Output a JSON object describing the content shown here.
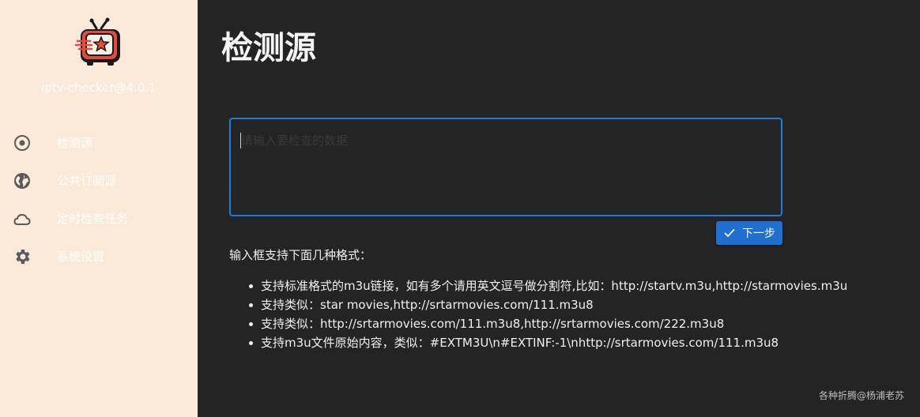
{
  "app": {
    "version": "iptv-checker@4.0.1",
    "logo_icon": "retro-tv-logo"
  },
  "sidebar": {
    "items": [
      {
        "label": "检测源",
        "icon": "radio-button-icon"
      },
      {
        "label": "公共订阅源",
        "icon": "globe-icon"
      },
      {
        "label": "定时检查任务",
        "icon": "cloud-icon"
      },
      {
        "label": "系统设置",
        "icon": "gear-icon"
      }
    ]
  },
  "main": {
    "title": "检测源",
    "input": {
      "value": "",
      "placeholder": "请输入要检查的数据"
    },
    "next_button": {
      "label": "下一步",
      "icon": "check-icon"
    },
    "help": {
      "title": "输入框支持下面几种格式：",
      "items": [
        "支持标准格式的m3u链接，如有多个请用英文逗号做分割符,比如：http://startv.m3u,http://starmovies.m3u",
        "支持类似：star movies,http://srtarmovies.com/111.m3u8",
        "支持类似：http://srtarmovies.com/111.m3u8,http://srtarmovies.com/222.m3u8",
        "支持m3u文件原始内容，类似：#EXTM3U\\n#EXTINF:-1\\nhttp://srtarmovies.com/111.m3u8"
      ]
    }
  },
  "watermark": "各种折腾@杨浦老苏",
  "colors": {
    "sidebar_bg": "#fbeada",
    "main_bg": "#242424",
    "accent": "#1f7ae0",
    "button": "#1f6fd1"
  }
}
